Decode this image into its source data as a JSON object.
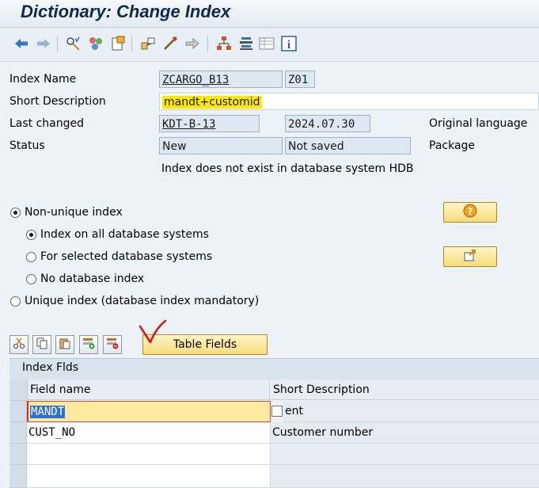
{
  "title": "Dictionary: Change Index",
  "toolbar": {
    "icons": [
      "back-icon",
      "forward-icon",
      "other-object-icon",
      "display-change-icon",
      "activate-icon",
      "where-used-icon",
      "check-icon",
      "where-used-list-icon",
      "object-list-icon",
      "navigation-window-icon",
      "table-display-icon",
      "info-icon"
    ]
  },
  "form": {
    "index_name_label": "Index Name",
    "index_name_value": "ZCARGO_B13",
    "index_id_value": "Z01",
    "short_desc_label": "Short Description",
    "short_desc_value": "mandt+customid",
    "last_changed_label": "Last changed",
    "last_changed_user": "KDT-B-13",
    "last_changed_date": "2024.07.30",
    "original_language_label": "Original language",
    "status_label": "Status",
    "status_value": "New",
    "save_status_value": "Not saved",
    "package_label": "Package",
    "db_message": "Index does not exist in database system HDB"
  },
  "options": {
    "non_unique": "Non-unique index",
    "all_db": "Index on all database systems",
    "selected_db": "For selected database systems",
    "no_db": "No database index",
    "unique": "Unique index (database index mandatory)"
  },
  "buttons": {
    "table_fields": "Table Fields"
  },
  "table": {
    "section_title": "Index Flds",
    "col_field": "Field name",
    "col_desc": "Short Description",
    "rows": [
      {
        "field": "MANDT",
        "desc": "ent"
      },
      {
        "field": "CUST_NO",
        "desc": "Customer number"
      },
      {
        "field": "",
        "desc": ""
      },
      {
        "field": "",
        "desc": ""
      }
    ]
  },
  "colors": {
    "highlight": "#ffe800",
    "accent_button": "#f7dc78",
    "title_text": "#0d2a4a",
    "annotation": "#e0141e"
  }
}
